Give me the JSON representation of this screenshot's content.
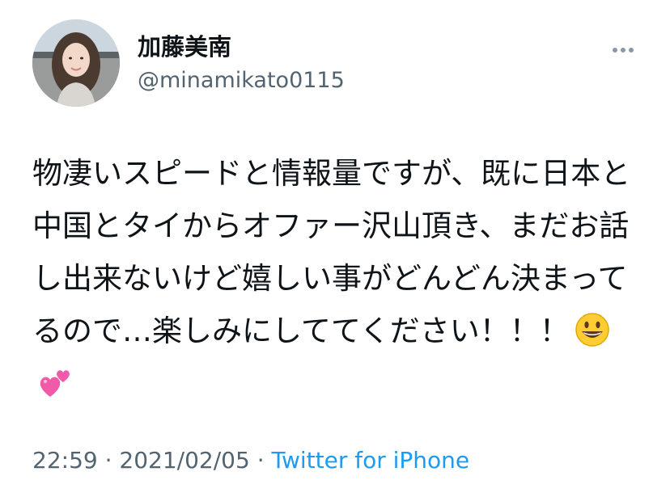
{
  "user": {
    "display_name": "加藤美南",
    "handle": "@minamikato0115",
    "avatar": "profile-photo"
  },
  "tweet": {
    "text": "物凄いスピードと情報量ですが、既に日本と中国とタイからオファー沢山頂き、まだお話し出来ないけど嬉しい事がどんどん決まってるので…楽しみにしててください！！！",
    "emojis": [
      "grinning-face-emoji",
      "two-hearts-emoji"
    ]
  },
  "meta": {
    "time": "22:59",
    "sep1": " · ",
    "date": "2021/02/05",
    "sep2": " · ",
    "source": "Twitter for iPhone"
  },
  "icons": {
    "more": "more-dots-icon"
  },
  "colors": {
    "text": "#0f1419",
    "secondary": "#536471",
    "link": "#1d9bf0",
    "background": "#ffffff"
  }
}
